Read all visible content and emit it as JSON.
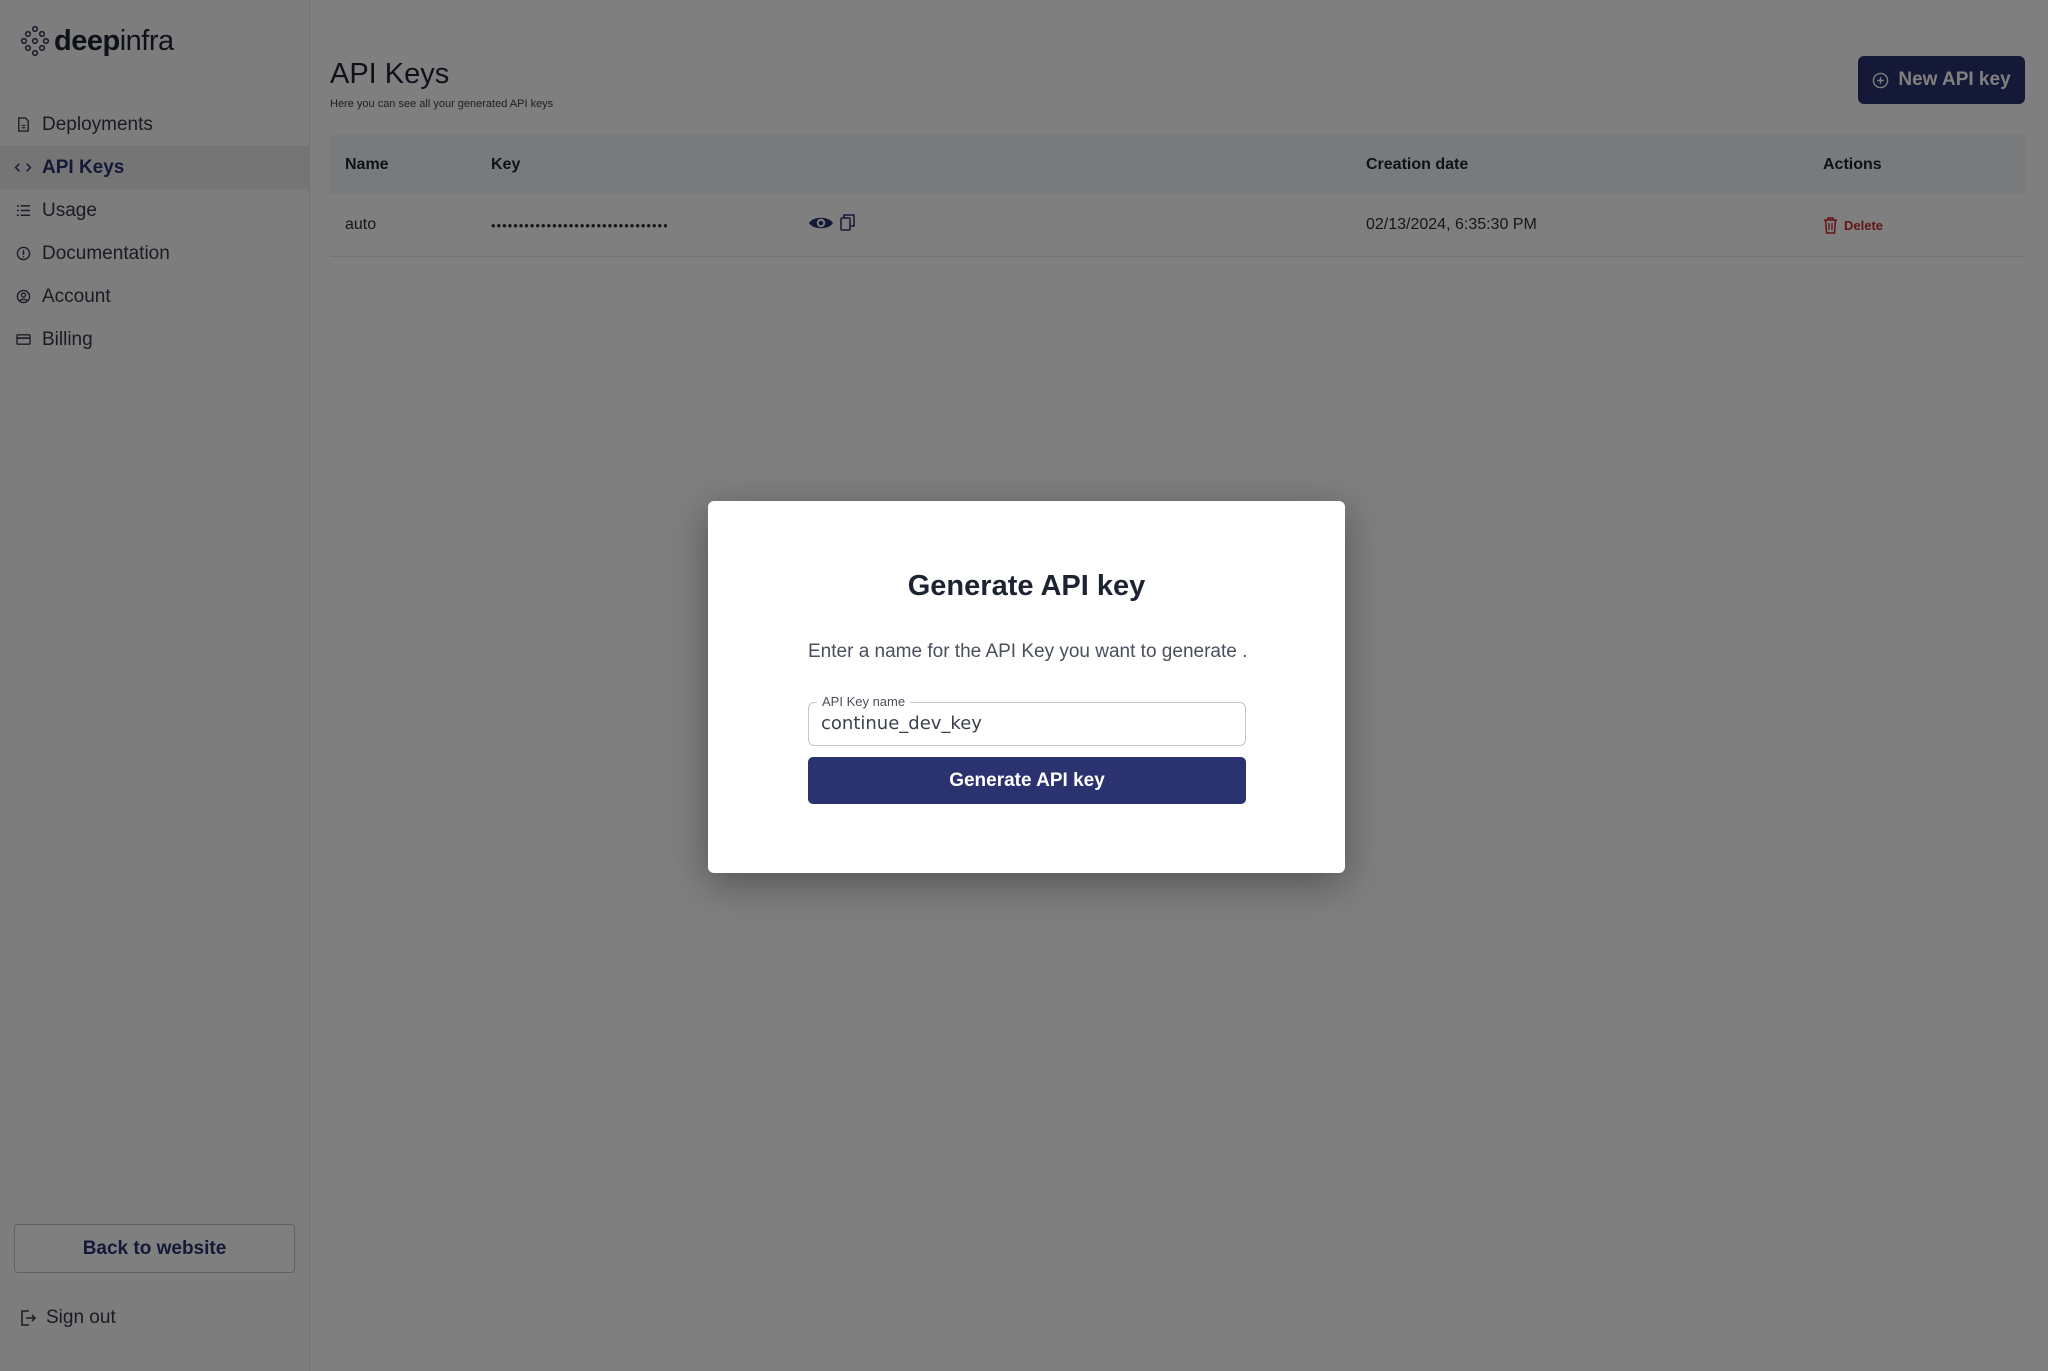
{
  "brand": {
    "name_bold": "deep",
    "name_light": "infra",
    "logo_icon": "deepinfra-logo-icon"
  },
  "sidebar": {
    "items": [
      {
        "label": "Deployments",
        "icon": "document-icon",
        "active": false
      },
      {
        "label": "API Keys",
        "icon": "code-brackets-icon",
        "active": true
      },
      {
        "label": "Usage",
        "icon": "list-icon",
        "active": false
      },
      {
        "label": "Documentation",
        "icon": "info-circle-icon",
        "active": false
      },
      {
        "label": "Account",
        "icon": "user-circle-icon",
        "active": false
      },
      {
        "label": "Billing",
        "icon": "credit-card-icon",
        "active": false
      }
    ],
    "back_label": "Back to website",
    "signout_label": "Sign out"
  },
  "header": {
    "title": "API Keys",
    "subtitle": "Here you can see all your generated API keys",
    "new_button_label": "New API key"
  },
  "table": {
    "columns": [
      "Name",
      "Key",
      "Creation date",
      "Actions"
    ],
    "rows": [
      {
        "name": "auto",
        "key_masked": "••••••••••••••••••••••••••••••••",
        "created": "02/13/2024, 6:35:30 PM",
        "action": "Delete"
      }
    ]
  },
  "modal": {
    "title": "Generate API key",
    "description": "Enter a name for the API Key you want to generate .",
    "field_label": "API Key name",
    "field_value": "continue_dev_key",
    "button_label": "Generate API key"
  },
  "colors": {
    "primary": "#2a3270",
    "danger": "#c82b2b",
    "overlay": "rgba(0,0,0,0.5)"
  }
}
